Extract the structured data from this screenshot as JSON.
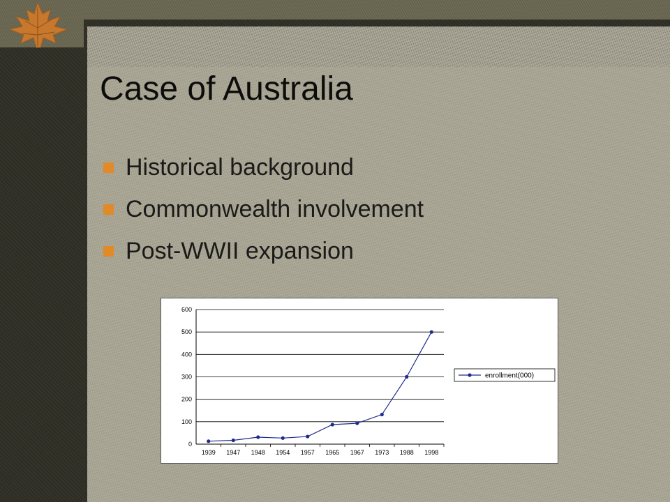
{
  "slide": {
    "title": "Case of Australia",
    "bullets": [
      "Historical background",
      "Commonwealth involvement",
      "Post-WWII expansion"
    ],
    "bullet_color": "#e08a28",
    "decoration_icon": "maple-leaf-icon"
  },
  "chart_data": {
    "type": "line",
    "categories": [
      "1939",
      "1947",
      "1948",
      "1954",
      "1957",
      "1965",
      "1967",
      "1973",
      "1988",
      "1998"
    ],
    "series": [
      {
        "name": "enrollment(000)",
        "values": [
          13,
          17,
          31,
          27,
          34,
          87,
          93,
          132,
          300,
          500
        ],
        "color": "#1f2a8c"
      }
    ],
    "yticks": [
      0,
      100,
      200,
      300,
      400,
      500,
      600
    ],
    "ylim": [
      0,
      600
    ],
    "legend": "right",
    "grid": true
  }
}
